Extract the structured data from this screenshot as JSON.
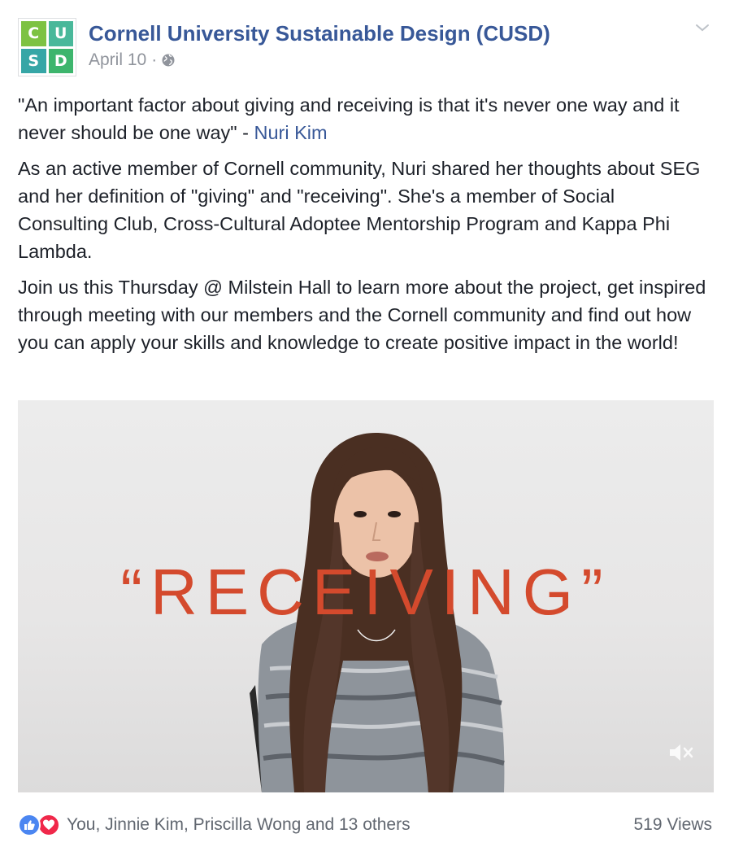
{
  "page": {
    "name": "Cornell University Sustainable Design (CUSD)",
    "date": "April 10",
    "separator": "·",
    "logo_letters": [
      "C",
      "U",
      "S",
      "D"
    ]
  },
  "post": {
    "quote_text": "\"An important factor about giving and receiving is that it's never one way and it never should be one way\" - ",
    "quote_mention": "Nuri Kim",
    "paragraph_2": "As an active member of Cornell community, Nuri shared her thoughts about SEG and her definition of \"giving\" and \"receiving\". She's a member of Social Consulting Club, Cross-Cultural Adoptee Mentorship Program and Kappa Phi Lambda.",
    "paragraph_3": "Join us this Thursday @ Milstein Hall to learn more about the project, get inspired through meeting with our members and the Cornell community and find out how you can apply your skills and knowledge to create positive impact in the world!"
  },
  "video": {
    "overlay_text": "“RECEIVING”",
    "muted": true
  },
  "footer": {
    "reactions": [
      "like-icon",
      "love-icon"
    ],
    "reacted_names": "You, Jinnie Kim, Priscilla Wong and 13 others",
    "views": "519 Views"
  },
  "colors": {
    "link": "#385898",
    "text": "#1d2129",
    "meta": "#90949c",
    "overlay": "#d44a2d",
    "like": "#4b86f1",
    "love": "#f0284a"
  }
}
